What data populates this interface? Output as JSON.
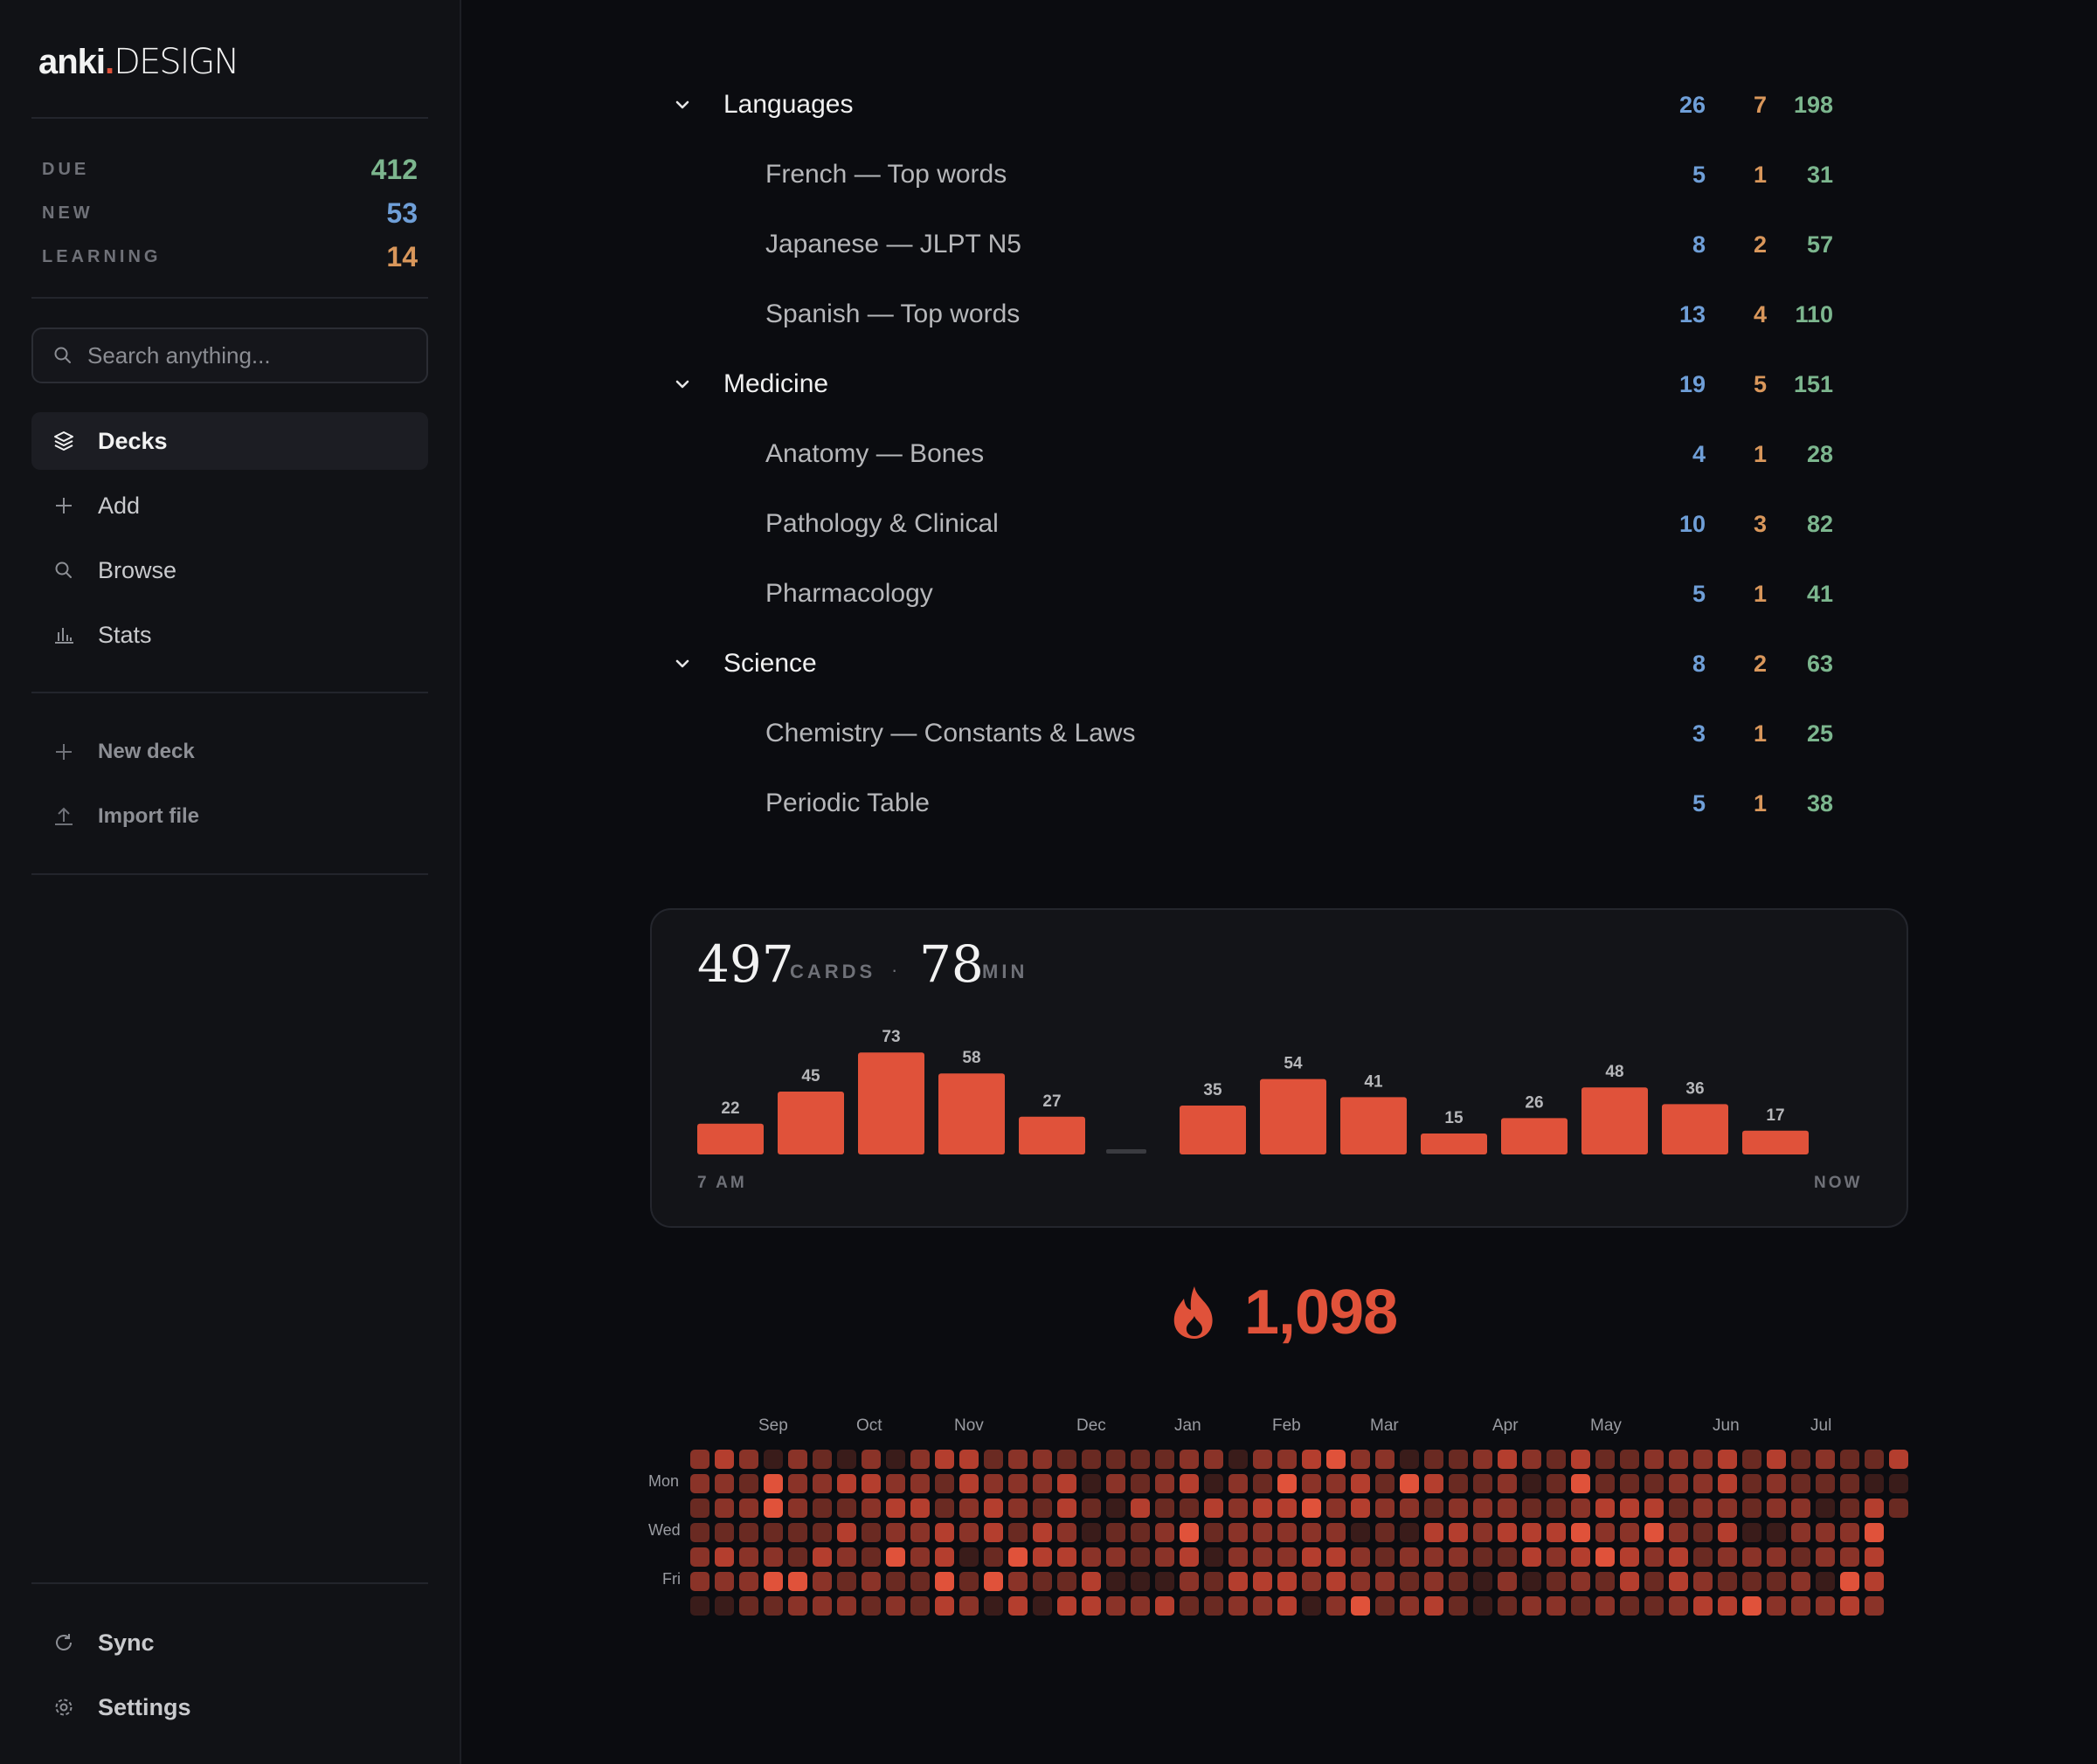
{
  "app": {
    "logo_main": "anki",
    "logo_dot": ".",
    "logo_suffix": "DESIGN"
  },
  "counters": [
    {
      "label": "DUE",
      "value": "412",
      "color": "#7cb68e"
    },
    {
      "label": "NEW",
      "value": "53",
      "color": "#6f9fd8"
    },
    {
      "label": "LEARNING",
      "value": "14",
      "color": "#d9975b"
    }
  ],
  "search": {
    "placeholder": "Search anything..."
  },
  "nav": [
    {
      "label": "Decks",
      "icon": "layers-icon",
      "active": true
    },
    {
      "label": "Add",
      "icon": "plus-icon"
    },
    {
      "label": "Browse",
      "icon": "search-icon"
    },
    {
      "label": "Stats",
      "icon": "bar-chart-icon"
    }
  ],
  "actions": [
    {
      "label": "New deck",
      "icon": "plus-icon"
    },
    {
      "label": "Import file",
      "icon": "upload-icon"
    }
  ],
  "footer": [
    {
      "label": "Sync",
      "icon": "sync-icon"
    },
    {
      "label": "Settings",
      "icon": "gear-icon"
    }
  ],
  "decks": [
    {
      "name": "Languages",
      "type": "parent",
      "new": "26",
      "learn": "7",
      "due": "198"
    },
    {
      "name": "French — Top words",
      "type": "child",
      "new": "5",
      "learn": "1",
      "due": "31"
    },
    {
      "name": "Japanese — JLPT N5",
      "type": "child",
      "new": "8",
      "learn": "2",
      "due": "57"
    },
    {
      "name": "Spanish — Top words",
      "type": "child",
      "new": "13",
      "learn": "4",
      "due": "110"
    },
    {
      "name": "Medicine",
      "type": "parent",
      "new": "19",
      "learn": "5",
      "due": "151"
    },
    {
      "name": "Anatomy — Bones",
      "type": "child",
      "new": "4",
      "learn": "1",
      "due": "28"
    },
    {
      "name": "Pathology & Clinical",
      "type": "child",
      "new": "10",
      "learn": "3",
      "due": "82"
    },
    {
      "name": "Pharmacology",
      "type": "child",
      "new": "5",
      "learn": "1",
      "due": "41"
    },
    {
      "name": "Science",
      "type": "parent",
      "new": "8",
      "learn": "2",
      "due": "63"
    },
    {
      "name": "Chemistry — Constants & Laws",
      "type": "child",
      "new": "3",
      "learn": "1",
      "due": "25"
    },
    {
      "name": "Periodic Table",
      "type": "child",
      "new": "5",
      "learn": "1",
      "due": "38"
    }
  ],
  "today": {
    "cards": "497",
    "cards_unit": "CARDS",
    "separator": "·",
    "minutes": "78",
    "minutes_unit": "MIN"
  },
  "chart_data": {
    "type": "bar",
    "values": [
      22,
      45,
      73,
      58,
      27,
      0,
      35,
      54,
      41,
      15,
      26,
      48,
      36,
      17
    ],
    "value_labels": [
      "22",
      "45",
      "73",
      "58",
      "27",
      "",
      "35",
      "54",
      "41",
      "15",
      "26",
      "48",
      "36",
      "17"
    ],
    "x_start_label": "7 AM",
    "x_end_label": "NOW",
    "color": "#e0523a",
    "empty_color": "#3a3b40"
  },
  "streak": {
    "value": "1,098",
    "icon": "flame-icon",
    "color": "#e0523a"
  },
  "heatmap": {
    "months": [
      "Sep",
      "Oct",
      "Nov",
      "Dec",
      "Jan",
      "Feb",
      "Mar",
      "Apr",
      "May",
      "Jun",
      "Jul"
    ],
    "day_labels": [
      "Mon",
      "Wed",
      "Fri"
    ],
    "weeks": 50,
    "days": 7,
    "colors": [
      "#3a1c1a",
      "#6a2a22",
      "#8a3328",
      "#b43e2e",
      "#e0523a"
    ]
  }
}
